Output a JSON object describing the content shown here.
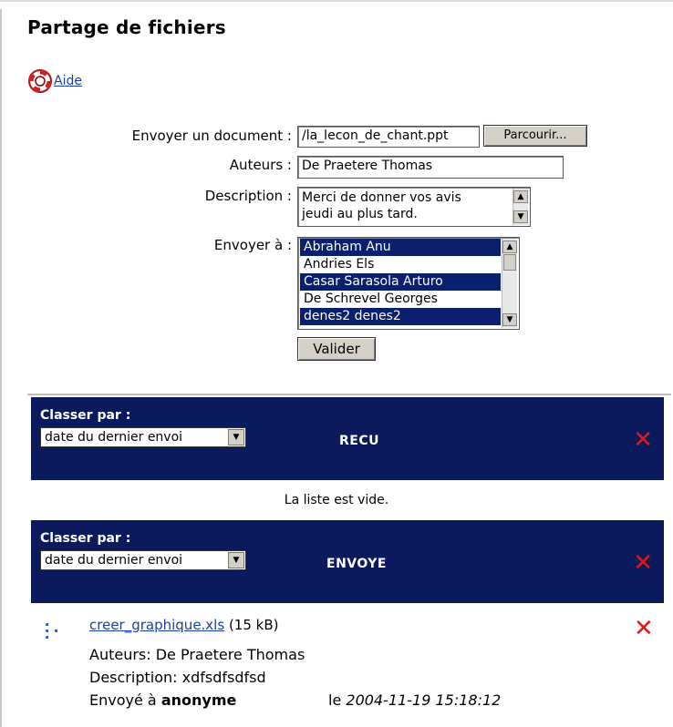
{
  "page": {
    "title": "Partage de fichiers",
    "help_label": "Aide"
  },
  "form": {
    "send_doc_label": "Envoyer un document :",
    "file_value": "/la_lecon_de_chant.ppt",
    "browse_label": "Parcourir...",
    "authors_label": "Auteurs :",
    "authors_value": "De Praetere Thomas",
    "description_label": "Description :",
    "description_lines": [
      "Merci de donner vos avis",
      "jeudi au plus tard."
    ],
    "send_to_label": "Envoyer à :",
    "recipients": [
      {
        "name": "Abraham Anu",
        "selected": true
      },
      {
        "name": "Andries Els",
        "selected": false
      },
      {
        "name": "Casar Sarasola Arturo",
        "selected": true
      },
      {
        "name": "De Schrevel Georges",
        "selected": false
      },
      {
        "name": "denes2 denes2",
        "selected": true
      }
    ],
    "submit_label": "Valider"
  },
  "received": {
    "sort_label": "Classer par :",
    "sort_value": "date du dernier envoi",
    "heading": "RECU",
    "empty_text": "La liste est vide."
  },
  "sent": {
    "sort_label": "Classer par :",
    "sort_value": "date du dernier envoi",
    "heading": "ENVOYE",
    "files": [
      {
        "name": "creer_graphique.xls",
        "size": "(15 kB)",
        "authors": "Auteurs: De Praetere Thomas",
        "description": "Description: xdfsdfsdfsd",
        "sent_to_prefix": "Envoyé à",
        "recipient": "anonyme",
        "date_prefix": "le",
        "date": "2004-11-19 15:18:12"
      }
    ]
  },
  "colors": {
    "bar_bg": "#0a1a5c",
    "selected_bg": "#0a1f6e",
    "delete_red": "#e01818",
    "link": "#1a3ea8"
  },
  "icons": {
    "help": "lifebuoy-icon",
    "delete": "red-x-icon",
    "file": "spreadsheet-icon"
  }
}
